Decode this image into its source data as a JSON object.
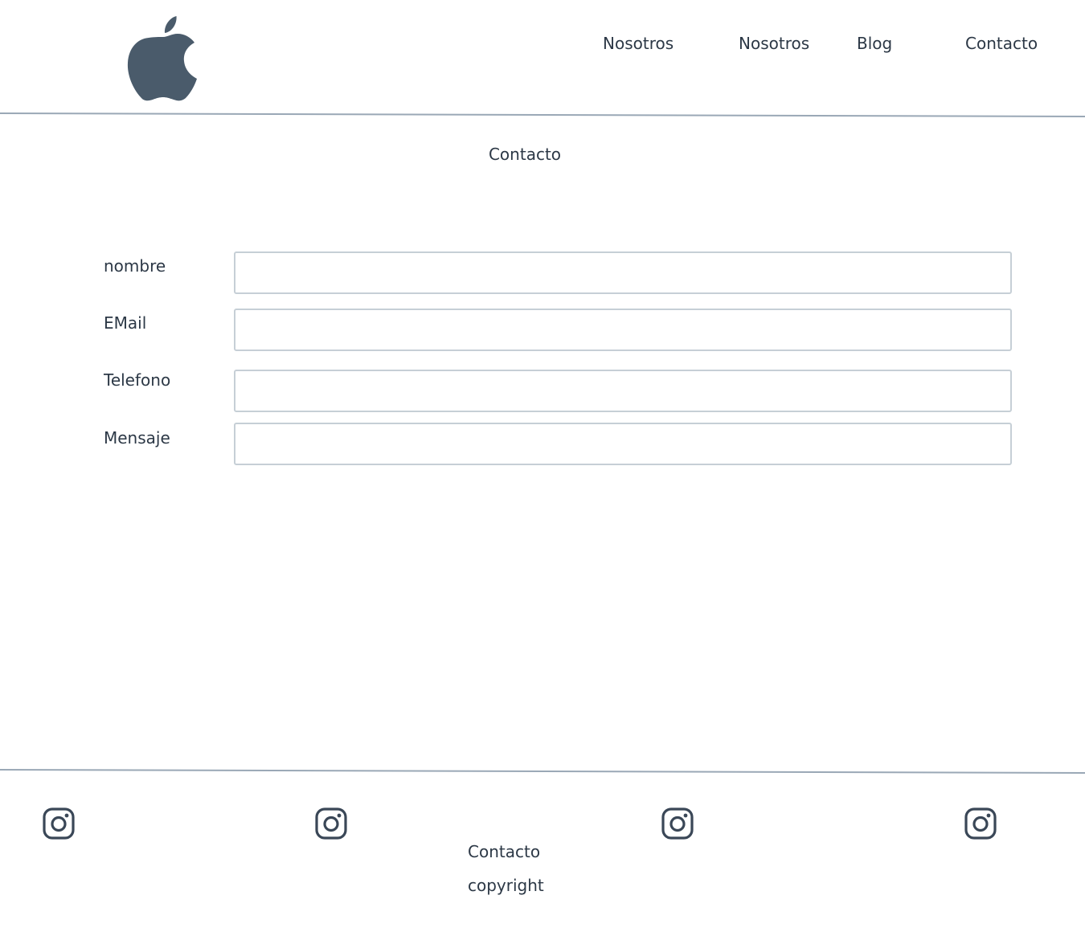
{
  "header": {
    "logo_icon": "apple-logo-icon",
    "nav": [
      {
        "label": "Nosotros"
      },
      {
        "label": "Nosotros"
      },
      {
        "label": "Blog"
      },
      {
        "label": "Contacto"
      }
    ]
  },
  "main": {
    "title": "Contacto",
    "form": {
      "fields": [
        {
          "label": "nombre",
          "value": "",
          "placeholder": ""
        },
        {
          "label": "EMail",
          "value": "",
          "placeholder": ""
        },
        {
          "label": "Telefono",
          "value": "",
          "placeholder": ""
        },
        {
          "label": "Mensaje",
          "value": "",
          "placeholder": ""
        }
      ]
    }
  },
  "footer": {
    "social_icons": [
      "instagram-icon",
      "instagram-icon",
      "instagram-icon",
      "instagram-icon"
    ],
    "contact": "Contacto",
    "copyright": "copyright"
  },
  "colors": {
    "text": "#2c3846",
    "logo": "#4a5b6b",
    "divider": "#9aa8b6",
    "input_border": "#c6cfd6",
    "icon": "#3a4757"
  }
}
